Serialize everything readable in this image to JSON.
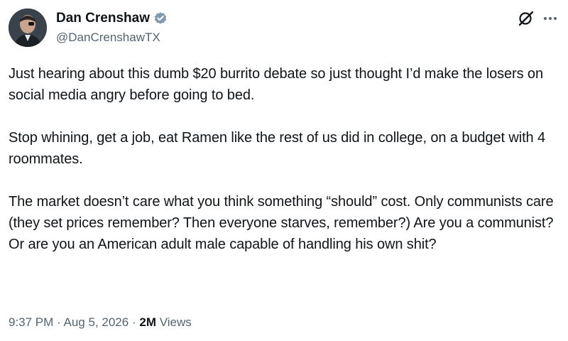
{
  "author": {
    "display_name": "Dan Crenshaw",
    "handle": "@DanCrenshawTX",
    "verified_icon": "verified-badge-icon",
    "badge_color": "#829aab"
  },
  "header_actions": {
    "grok_icon": "grok-icon",
    "more_icon": "more-horizontal-icon"
  },
  "tweet": {
    "paragraphs": [
      "Just hearing about this dumb $20 burrito debate so just thought I’d make the losers on social media angry before going to bed.",
      "Stop whining, get a job, eat Ramen like the rest of us did in college, on a budget with 4 roommates.",
      "The market doesn’t care what you think something “should” cost. Only communists care (they set prices remember? Then everyone starves, remember?) Are you a communist? Or are you an American adult male capable of handling his own shit?"
    ]
  },
  "meta": {
    "time": "9:37 PM",
    "separator": "·",
    "date": "Aug 5, 2026",
    "views_count": "2M",
    "views_label": "Views"
  },
  "colors": {
    "text_primary": "#0f1419",
    "text_secondary": "#536471",
    "background": "#ffffff"
  }
}
